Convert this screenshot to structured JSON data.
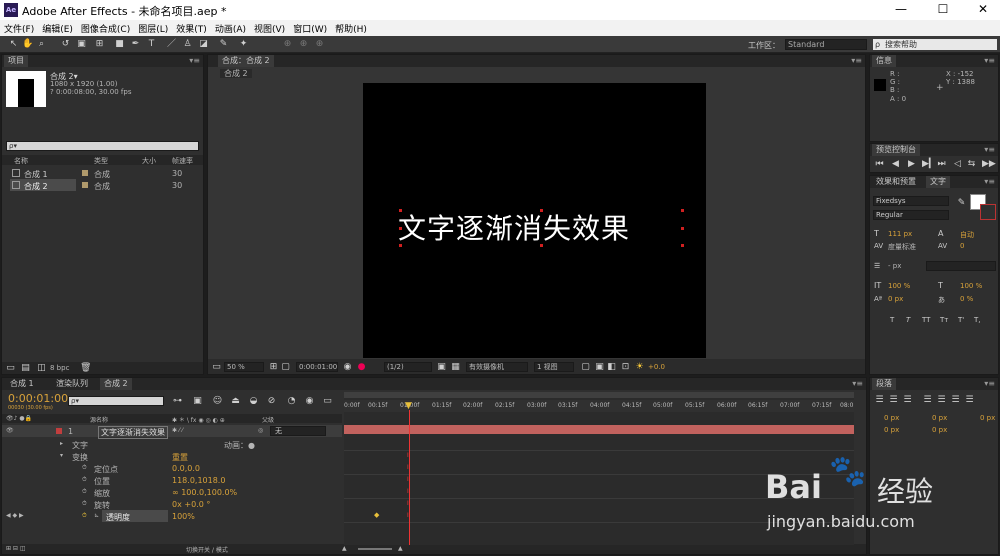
{
  "window": {
    "app_icon": "Ae",
    "title": "Adobe After Effects - 未命名项目.aep *",
    "controls": [
      "—",
      "☐",
      "✕"
    ]
  },
  "menu": [
    "文件(F)",
    "编辑(E)",
    "图像合成(C)",
    "图层(L)",
    "效果(T)",
    "动画(A)",
    "视图(V)",
    "窗口(W)",
    "帮助(H)"
  ],
  "toolbar": {
    "workspace_label": "工作区：",
    "workspace_value": "Standard",
    "help_search": "搜索帮助"
  },
  "project": {
    "tab": "项目",
    "comp_name": "合成 2▾",
    "comp_size": "1080 x 1920 (1.00)",
    "comp_dur": "? 0:00:08:00, 30.00 fps",
    "search_placeholder": "ρ▾",
    "headers": {
      "name": "名称",
      "type": "类型",
      "size": "大小",
      "fps": "帧速率"
    },
    "items": [
      {
        "name": "合成 1",
        "type": "合成",
        "fps": "30"
      },
      {
        "name": "合成 2",
        "type": "合成",
        "fps": "30"
      }
    ],
    "bpc": "8 bpc"
  },
  "composition": {
    "tab": "合成：合成 2",
    "sub_tab": "合成 2",
    "text": "文字逐渐消失效果",
    "zoom": "50 %",
    "timecode": "0:00:01:00",
    "resolution": "(1/2)",
    "camera": "有效摄像机",
    "views": "1 视图",
    "exposure": "+0.0"
  },
  "info": {
    "tab": "信息",
    "r": "R :",
    "g": "G :",
    "b": "B :",
    "a": "A :  0",
    "x": "X : -152",
    "y": "Y : 1388"
  },
  "preview": {
    "tab": "预览控制台"
  },
  "character": {
    "tab1": "效果和预置",
    "tab2": "文字",
    "font": "Fixedsys",
    "style": "Regular",
    "size": "111 px",
    "leading": "自动",
    "kerning": "度量标准",
    "tracking": "0",
    "stroke": "- px",
    "vscale": "100 %",
    "hscale": "100 %",
    "baseline": "0 px",
    "tsume": "0 %",
    "styles": [
      "T",
      "T",
      "TT",
      "Tт",
      "T'",
      "T,"
    ]
  },
  "paragraph": {
    "tab": "段落",
    "v1": "0 px",
    "v2": "0 px",
    "v3": "0 px",
    "v4": "0 px",
    "v5": "0 px"
  },
  "timeline": {
    "tabs": [
      "合成 1",
      "渲染队列",
      "合成 2"
    ],
    "time": "0:00:01:00",
    "time_sub": "00030 (30.00 fps)",
    "search": "ρ▾",
    "col_name": "源名称",
    "col_parent": "父级",
    "layer_num": "1",
    "layer_name": "文字逐渐消失效果",
    "parent_value": "无",
    "rows": [
      {
        "label": "文字",
        "value": "动画：●"
      },
      {
        "label": "变换",
        "value": "重置"
      },
      {
        "label": "定位点",
        "value": "0.0,0.0"
      },
      {
        "label": "位置",
        "value": "118.0,1018.0"
      },
      {
        "label": "缩放",
        "value": "∞ 100.0,100.0%"
      },
      {
        "label": "旋转",
        "value": "0x +0.0 °"
      },
      {
        "label": "透明度",
        "value": "100%"
      }
    ],
    "ruler": [
      "0:00f",
      "00:15f",
      "01:00f",
      "01:15f",
      "02:00f",
      "02:15f",
      "03:00f",
      "03:15f",
      "04:00f",
      "04:15f",
      "05:00f",
      "05:15f",
      "06:00f",
      "06:15f",
      "07:00f",
      "07:15f",
      "08:0"
    ],
    "footer": "切换开关 / 模式"
  },
  "watermark": {
    "brand": "Bai",
    "suffix": "经验",
    "url": "jingyan.baidu.com"
  }
}
